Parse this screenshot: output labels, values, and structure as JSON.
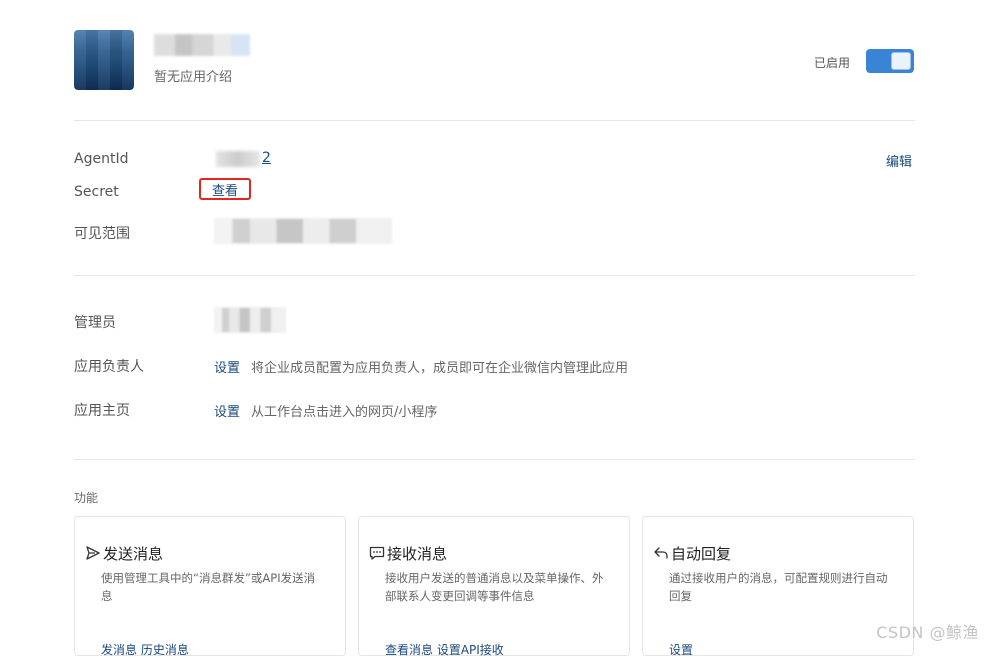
{
  "app": {
    "description": "暂无应用介绍",
    "status_label": "已启用",
    "enabled": true
  },
  "info": {
    "agentid_label": "AgentId",
    "agentid_visible_tail": "2",
    "edit_label": "编辑",
    "secret_label": "Secret",
    "secret_view_label": "查看",
    "visibility_label": "可见范围"
  },
  "roles": {
    "admin_label": "管理员",
    "owner_label": "应用负责人",
    "owner_action": "设置",
    "owner_hint": "将企业成员配置为应用负责人，成员即可在企业微信内管理此应用",
    "homepage_label": "应用主页",
    "homepage_action": "设置",
    "homepage_hint": "从工作台点击进入的网页/小程序"
  },
  "features": {
    "title": "功能",
    "cards": [
      {
        "icon": "send-icon",
        "title": "发送消息",
        "desc": "使用管理工具中的“消息群发”或API发送消息",
        "actions": "发消息  历史消息"
      },
      {
        "icon": "chat-icon",
        "title": "接收消息",
        "desc": "接收用户发送的普通消息以及菜单操作、外部联系人变更回调等事件信息",
        "actions": "查看消息  设置API接收"
      },
      {
        "icon": "reply-icon",
        "title": "自动回复",
        "desc": "通过接收用户的消息，可配置规则进行自动回复",
        "actions": "设置"
      }
    ]
  },
  "watermark": "CSDN @鲸渔",
  "colors": {
    "accent": "#3a84d6",
    "link": "#1a4a7c",
    "highlight_border": "#e0281e"
  }
}
